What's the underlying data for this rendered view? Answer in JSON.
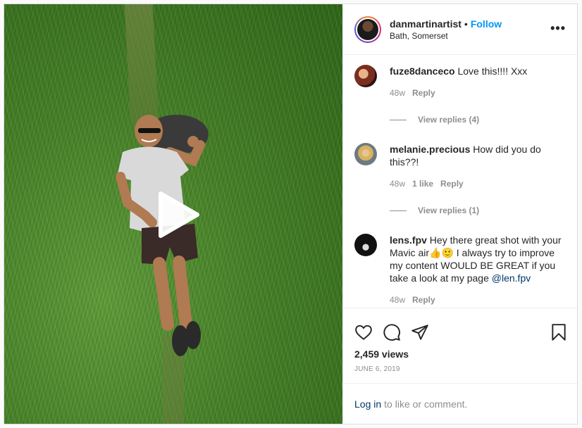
{
  "header": {
    "username": "danmartinartist",
    "separator": "•",
    "follow_label": "Follow",
    "location": "Bath, Somerset",
    "more_label": "•••"
  },
  "comments": [
    {
      "username": "fuze8danceco",
      "text": "Love this!!!! Xxx",
      "time": "48w",
      "likes": "",
      "reply_label": "Reply",
      "view_replies": "View replies (4)"
    },
    {
      "username": "melanie.precious",
      "text": "How did you do this??!",
      "time": "48w",
      "likes": "1 like",
      "reply_label": "Reply",
      "view_replies": "View replies (1)"
    },
    {
      "username": "lens.fpv",
      "text": "Hey there great shot with your Mavic air👍🙂 I always try to improve my content WOULD BE GREAT if you take a look at my page",
      "mention": "@len.fpv",
      "time": "48w",
      "likes": "",
      "reply_label": "Reply"
    }
  ],
  "stats": {
    "views": "2,459 views",
    "date": "JUNE 6, 2019"
  },
  "login": {
    "link_label": "Log in",
    "text": "to like or comment."
  },
  "icons": {
    "like": "heart-icon",
    "comment": "comment-icon",
    "share": "share-icon",
    "save": "bookmark-icon",
    "play": "play-icon"
  },
  "colors": {
    "link": "#0095f6",
    "muted": "#8e8e8e",
    "text": "#262626"
  }
}
